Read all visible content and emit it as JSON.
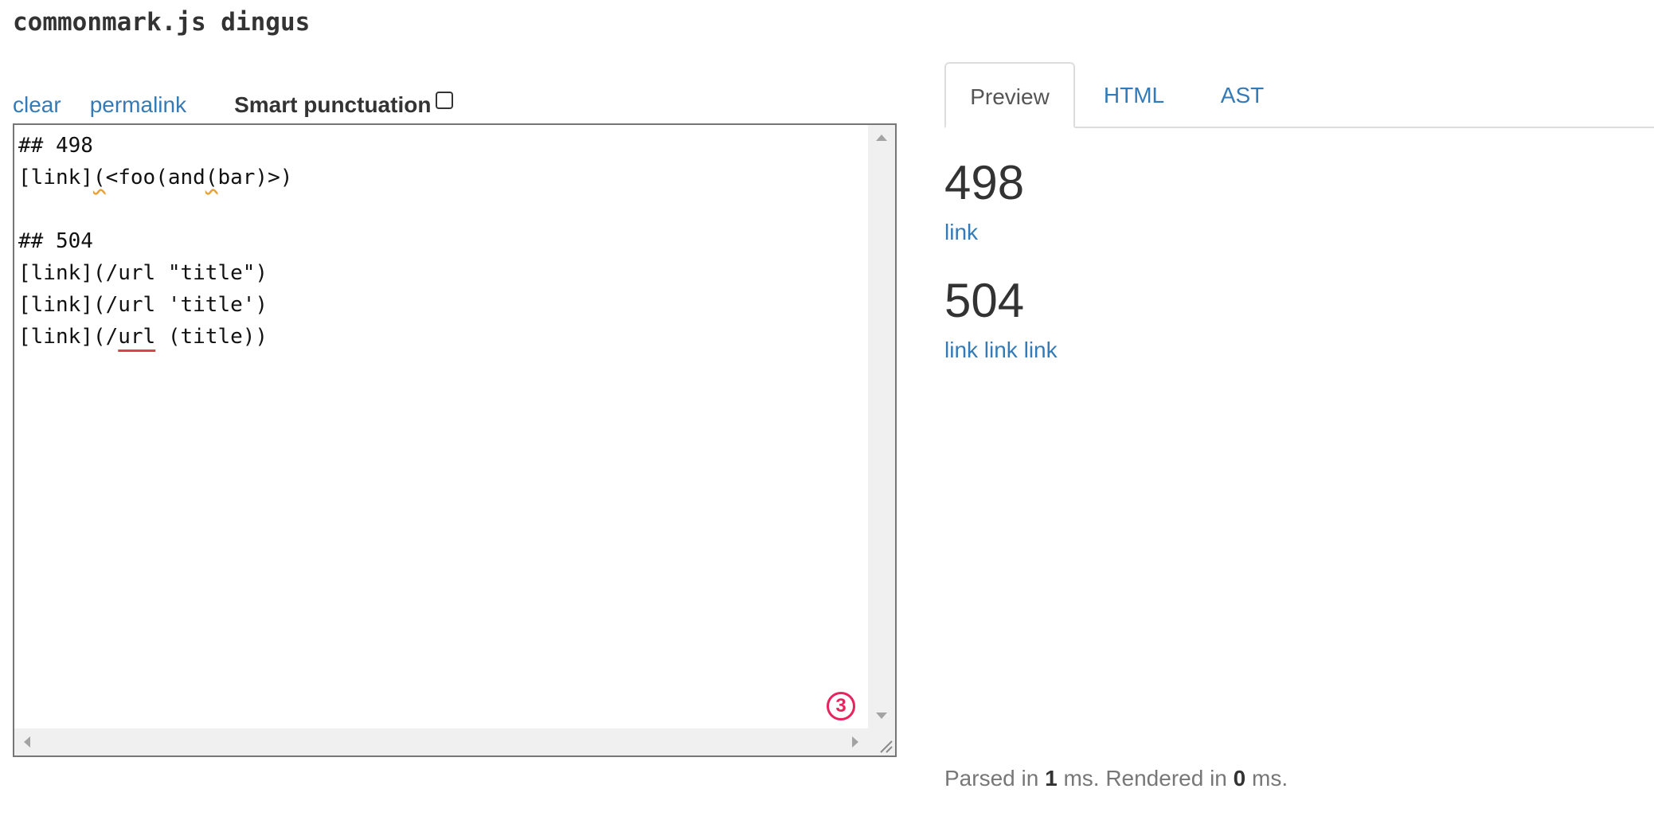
{
  "header": {
    "title": "commonmark.js dingus"
  },
  "toolbar": {
    "clear_label": "clear",
    "permalink_label": "permalink",
    "smart_punctuation_label": "Smart punctuation",
    "smart_punctuation_checked": false
  },
  "editor": {
    "lines": [
      "## 498",
      "[link](<foo(and(bar)>)",
      "",
      "## 504",
      "[link](/url \"title\")",
      "[link](/url 'title')",
      "[link](/url (title))"
    ],
    "line1_parts": [
      "[link]",
      "(",
      "<foo(and",
      "(",
      "bar)>)"
    ],
    "line6_parts": [
      "[link](/",
      "url",
      " (title))"
    ],
    "badge_count": "3"
  },
  "tabs": [
    {
      "label": "Preview",
      "active": true
    },
    {
      "label": "HTML",
      "active": false
    },
    {
      "label": "AST",
      "active": false
    }
  ],
  "preview": {
    "section1": {
      "heading": "498",
      "links": [
        "link"
      ]
    },
    "section2": {
      "heading": "504",
      "links": [
        "link",
        "link",
        "link"
      ]
    }
  },
  "status": {
    "parsed_prefix": "Parsed in",
    "parsed_ms": "1",
    "rendered_prefix": "ms. Rendered in",
    "rendered_ms": "0",
    "suffix": "ms."
  },
  "colors": {
    "link": "#337ab7",
    "text": "#333333",
    "badge": "#e6245e",
    "warning_squiggle": "#e8a23a",
    "error_squiggle": "#e0404a"
  }
}
